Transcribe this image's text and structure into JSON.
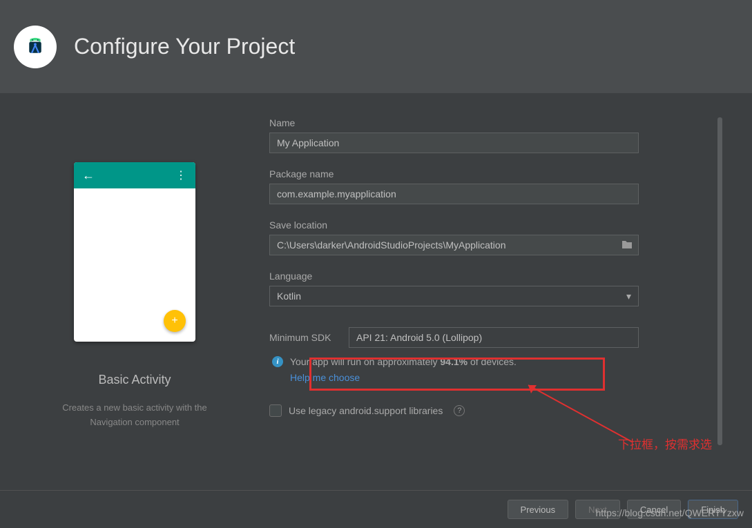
{
  "header": {
    "title": "Configure Your Project"
  },
  "preview": {
    "name": "Basic Activity",
    "description": "Creates a new basic activity with the Navigation component"
  },
  "form": {
    "name": {
      "label": "Name",
      "value": "My Application"
    },
    "package": {
      "label": "Package name",
      "value": "com.example.myapplication"
    },
    "save": {
      "label": "Save location",
      "value": "C:\\Users\\darker\\AndroidStudioProjects\\MyApplication"
    },
    "language": {
      "label": "Language",
      "value": "Kotlin"
    },
    "sdk": {
      "label": "Minimum SDK",
      "value": "API 21: Android 5.0 (Lollipop)"
    },
    "info_prefix": "Your app will run on approximately ",
    "info_percent": "94.1%",
    "info_suffix": " of devices.",
    "help": "Help me choose",
    "legacy": "Use legacy android.support libraries"
  },
  "buttons": {
    "previous": "Previous",
    "next": "Next",
    "cancel": "Cancel",
    "finish": "Finish"
  },
  "annotation": {
    "text": "下拉框，按需求选"
  },
  "watermark": "https://blog.csdn.net/QWERTYzxw"
}
